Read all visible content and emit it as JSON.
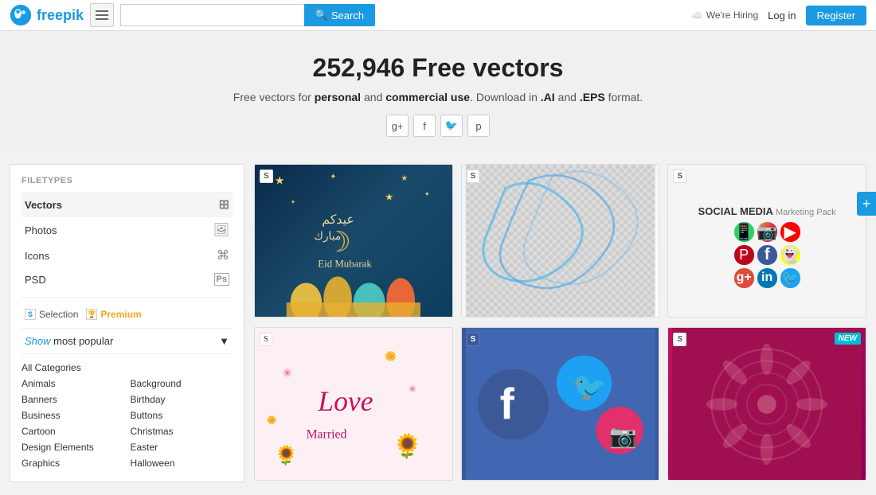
{
  "header": {
    "logo_text": "freepik",
    "search_placeholder": "",
    "search_button_label": "Search",
    "hiring_text": "We're Hiring",
    "login_label": "Log in",
    "register_label": "Register"
  },
  "hero": {
    "title": "252,946 Free vectors",
    "description_prefix": "Free vectors for ",
    "description_bold1": "personal",
    "description_middle": " and ",
    "description_bold2": "commercial use",
    "description_suffix": ". Download in ",
    "format1": ".AI",
    "description_and": " and ",
    "format2": ".EPS",
    "description_end": " format."
  },
  "social_icons": [
    {
      "name": "google-plus",
      "symbol": "g+"
    },
    {
      "name": "facebook",
      "symbol": "f"
    },
    {
      "name": "twitter",
      "symbol": "🐦"
    },
    {
      "name": "pinterest",
      "symbol": "p"
    }
  ],
  "sidebar": {
    "filetypes_label": "FILETYPES",
    "items": [
      {
        "label": "Vectors",
        "icon": "⊞",
        "active": true
      },
      {
        "label": "Photos",
        "icon": "🖼",
        "active": false
      },
      {
        "label": "Icons",
        "icon": "⌘",
        "active": false
      },
      {
        "label": "PSD",
        "icon": "Ps",
        "active": false
      }
    ],
    "selection_label": "Selection",
    "premium_label": "Premium",
    "show_label": "Show",
    "most_popular_label": "most popular",
    "categories": {
      "all": "All Categories",
      "col1": [
        "Animals",
        "Banners",
        "Business",
        "Cartoon",
        "Design Elements",
        "Graphics"
      ],
      "col2": [
        "Background",
        "Birthday",
        "Buttons",
        "Christmas",
        "Easter",
        "Halloween"
      ]
    }
  },
  "grid_items": [
    {
      "id": "eid",
      "badge": "S",
      "type": "eid",
      "title": "Eid Mubarak"
    },
    {
      "id": "wave",
      "badge": "S",
      "type": "wave",
      "title": "Wave background"
    },
    {
      "id": "social-media",
      "badge": "S",
      "type": "social",
      "title": "Social Media Marketing Pack"
    },
    {
      "id": "love",
      "badge": "S",
      "type": "love",
      "title": "Love Married"
    },
    {
      "id": "facebook",
      "badge": "S",
      "type": "facebook",
      "title": "Facebook Social Icons"
    },
    {
      "id": "pink-pattern",
      "badge": "S",
      "type": "pink",
      "title": "Pink Pattern",
      "new": true
    }
  ],
  "plus_btn_label": "+"
}
